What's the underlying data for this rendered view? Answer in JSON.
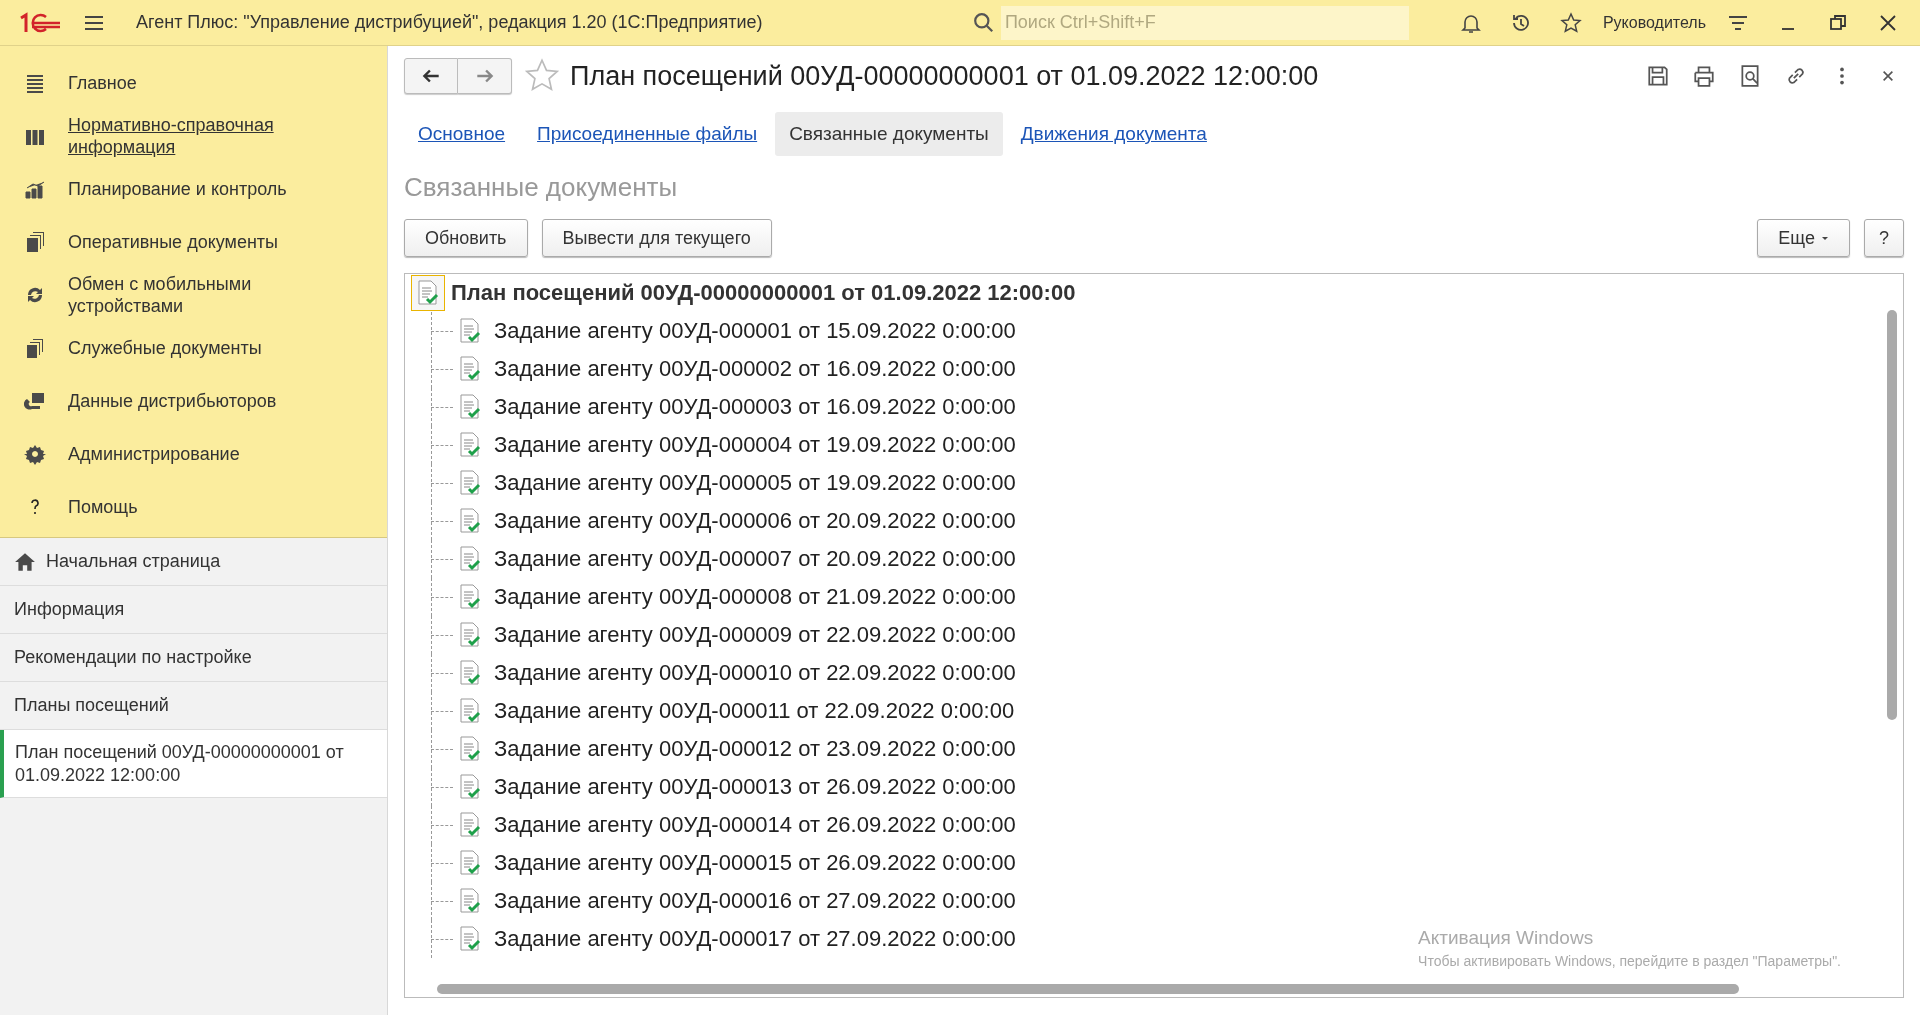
{
  "titlebar": {
    "title": "Агент Плюс: \"Управление дистрибуцией\", редакция 1.20  (1С:Предприятие)",
    "search_placeholder": "Поиск Ctrl+Shift+F",
    "user": "Руководитель"
  },
  "sidebar": {
    "sections": [
      {
        "label": "Главное",
        "link": false
      },
      {
        "label": "Нормативно-справочная информация",
        "link": true
      },
      {
        "label": "Планирование и контроль",
        "link": false
      },
      {
        "label": "Оперативные документы",
        "link": false
      },
      {
        "label": "Обмен с мобильными устройствами",
        "link": false
      },
      {
        "label": "Служебные документы",
        "link": false
      },
      {
        "label": "Данные дистрибьюторов",
        "link": false
      },
      {
        "label": "Администрирование",
        "link": false
      },
      {
        "label": "Помощь",
        "link": false
      }
    ],
    "open_windows": [
      {
        "label": "Начальная страница",
        "home": true,
        "selected": false
      },
      {
        "label": "Информация",
        "home": false,
        "selected": false
      },
      {
        "label": "Рекомендации по настройке",
        "home": false,
        "selected": false
      },
      {
        "label": "Планы посещений",
        "home": false,
        "selected": false
      },
      {
        "label": "План посещений 00УД-00000000001 от 01.09.2022 12:00:00",
        "home": false,
        "selected": true
      }
    ]
  },
  "document": {
    "title": "План посещений 00УД-00000000001 от 01.09.2022 12:00:00",
    "tabs": [
      {
        "label": "Основное",
        "selected": false
      },
      {
        "label": "Присоединенные файлы",
        "selected": false
      },
      {
        "label": "Связанные документы",
        "selected": true
      },
      {
        "label": "Движения документа",
        "selected": false
      }
    ],
    "section_title": "Связанные документы",
    "buttons": [
      "Обновить",
      "Вывести для текущего"
    ],
    "more_button": "Еще",
    "help_button": "?",
    "tree": {
      "label": "План посещений 00УД-00000000001 от 01.09.2022 12:00:00",
      "children": [
        {
          "label": "Задание агенту 00УД-000001 от 15.09.2022 0:00:00"
        },
        {
          "label": "Задание агенту 00УД-000002 от 16.09.2022 0:00:00"
        },
        {
          "label": "Задание агенту 00УД-000003 от 16.09.2022 0:00:00"
        },
        {
          "label": "Задание агенту 00УД-000004 от 19.09.2022 0:00:00"
        },
        {
          "label": "Задание агенту 00УД-000005 от 19.09.2022 0:00:00"
        },
        {
          "label": "Задание агенту 00УД-000006 от 20.09.2022 0:00:00"
        },
        {
          "label": "Задание агенту 00УД-000007 от 20.09.2022 0:00:00"
        },
        {
          "label": "Задание агенту 00УД-000008 от 21.09.2022 0:00:00"
        },
        {
          "label": "Задание агенту 00УД-000009 от 22.09.2022 0:00:00"
        },
        {
          "label": "Задание агенту 00УД-000010 от 22.09.2022 0:00:00"
        },
        {
          "label": "Задание агенту 00УД-000011 от 22.09.2022 0:00:00"
        },
        {
          "label": "Задание агенту 00УД-000012 от 23.09.2022 0:00:00"
        },
        {
          "label": "Задание агенту 00УД-000013 от 26.09.2022 0:00:00"
        },
        {
          "label": "Задание агенту 00УД-000014 от 26.09.2022 0:00:00"
        },
        {
          "label": "Задание агенту 00УД-000015 от 26.09.2022 0:00:00"
        },
        {
          "label": "Задание агенту 00УД-000016 от 27.09.2022 0:00:00"
        },
        {
          "label": "Задание агенту 00УД-000017 от 27.09.2022 0:00:00"
        }
      ]
    }
  },
  "activation_notice": {
    "title": "Активация Windows",
    "text": "Чтобы активировать Windows, перейдите в раздел \"Параметры\"."
  }
}
